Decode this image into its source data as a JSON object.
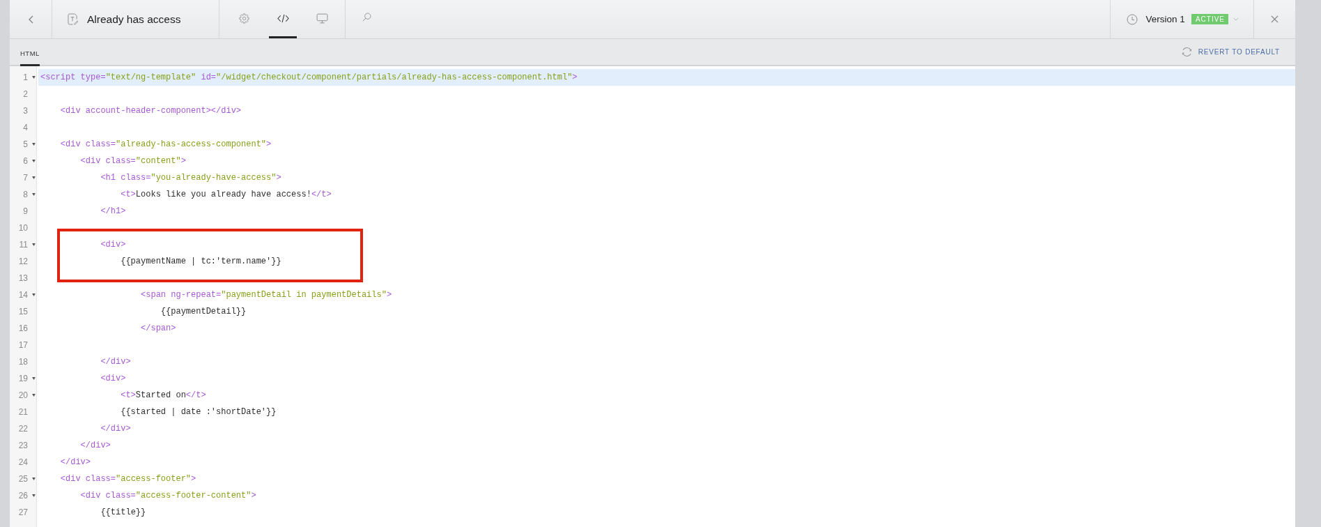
{
  "toolbar": {
    "title": "Already has access",
    "tabs": [
      {
        "kind": "settings",
        "selected": false
      },
      {
        "kind": "code",
        "selected": true
      },
      {
        "kind": "preview",
        "selected": false
      }
    ],
    "version": {
      "label": "Version 1",
      "status": "ACTIVE"
    }
  },
  "subtabs": [
    {
      "label": "HTML",
      "selected": true
    }
  ],
  "revert_button": "REVERT TO DEFAULT",
  "code": {
    "lines": [
      {
        "number": "1",
        "fold": true,
        "active": true,
        "boxed": false,
        "tokens": [
          {
            "kind": "tag",
            "text": "<script type="
          },
          {
            "kind": "string",
            "text": "\"text/ng-template\""
          },
          {
            "kind": "tag",
            "text": " id="
          },
          {
            "kind": "string",
            "text": "\"/widget/checkout/component/partials/already-has-access-component.html\""
          },
          {
            "kind": "tag",
            "text": ">"
          }
        ]
      },
      {
        "number": "2",
        "fold": false,
        "active": false,
        "boxed": false
      },
      {
        "number": "3",
        "fold": false,
        "active": false,
        "boxed": false,
        "tokens": [
          {
            "kind": "tag",
            "text": "    <div account-header-component></div>"
          }
        ]
      },
      {
        "number": "4",
        "fold": false,
        "active": false,
        "boxed": false
      },
      {
        "number": "5",
        "fold": true,
        "active": false,
        "boxed": false,
        "tokens": [
          {
            "kind": "tag",
            "text": "    <div class="
          },
          {
            "kind": "string",
            "text": "\"already-has-access-component\""
          },
          {
            "kind": "tag",
            "text": ">"
          }
        ]
      },
      {
        "number": "6",
        "fold": true,
        "active": false,
        "boxed": false,
        "tokens": [
          {
            "kind": "tag",
            "text": "        <div class="
          },
          {
            "kind": "string",
            "text": "\"content\""
          },
          {
            "kind": "tag",
            "text": ">"
          }
        ]
      },
      {
        "number": "7",
        "fold": true,
        "active": false,
        "boxed": false,
        "tokens": [
          {
            "kind": "tag",
            "text": "            <h1 class="
          },
          {
            "kind": "string",
            "text": "\"you-already-have-access\""
          },
          {
            "kind": "tag",
            "text": ">"
          }
        ]
      },
      {
        "number": "8",
        "fold": true,
        "active": false,
        "boxed": false,
        "tokens": [
          {
            "kind": "tag",
            "text": "                <t>"
          },
          {
            "kind": "text",
            "text": "Looks like you already have access!"
          },
          {
            "kind": "tag",
            "text": "</t>"
          }
        ]
      },
      {
        "number": "9",
        "fold": false,
        "active": false,
        "boxed": false,
        "tokens": [
          {
            "kind": "tag",
            "text": "            </h1>"
          }
        ]
      },
      {
        "number": "10",
        "fold": false,
        "active": false,
        "boxed": false
      },
      {
        "number": "11",
        "fold": true,
        "active": false,
        "boxed": true,
        "tokens": [
          {
            "kind": "tag",
            "text": "            <div>"
          }
        ]
      },
      {
        "number": "12",
        "fold": false,
        "active": false,
        "boxed": true,
        "tokens": [
          {
            "kind": "text",
            "text": "                {{paymentName | tc:'term.name'}}"
          }
        ]
      },
      {
        "number": "13",
        "fold": false,
        "active": false,
        "boxed": true
      },
      {
        "number": "14",
        "fold": true,
        "active": false,
        "boxed": false,
        "tokens": [
          {
            "kind": "tag",
            "text": "                    <span ng-repeat="
          },
          {
            "kind": "string",
            "text": "\"paymentDetail in paymentDetails\""
          },
          {
            "kind": "tag",
            "text": ">"
          }
        ]
      },
      {
        "number": "15",
        "fold": false,
        "active": false,
        "boxed": false,
        "tokens": [
          {
            "kind": "text",
            "text": "                        {{paymentDetail}}"
          }
        ]
      },
      {
        "number": "16",
        "fold": false,
        "active": false,
        "boxed": false,
        "tokens": [
          {
            "kind": "tag",
            "text": "                    </span>"
          }
        ]
      },
      {
        "number": "17",
        "fold": false,
        "active": false,
        "boxed": false
      },
      {
        "number": "18",
        "fold": false,
        "active": false,
        "boxed": false,
        "tokens": [
          {
            "kind": "tag",
            "text": "            </div>"
          }
        ]
      },
      {
        "number": "19",
        "fold": true,
        "active": false,
        "boxed": false,
        "tokens": [
          {
            "kind": "tag",
            "text": "            <div>"
          }
        ]
      },
      {
        "number": "20",
        "fold": true,
        "active": false,
        "boxed": false,
        "tokens": [
          {
            "kind": "tag",
            "text": "                <t>"
          },
          {
            "kind": "text",
            "text": "Started on"
          },
          {
            "kind": "tag",
            "text": "</t>"
          }
        ]
      },
      {
        "number": "21",
        "fold": false,
        "active": false,
        "boxed": false,
        "tokens": [
          {
            "kind": "text",
            "text": "                {{started | date :'shortDate'}}"
          }
        ]
      },
      {
        "number": "22",
        "fold": false,
        "active": false,
        "boxed": false,
        "tokens": [
          {
            "kind": "tag",
            "text": "            </div>"
          }
        ]
      },
      {
        "number": "23",
        "fold": false,
        "active": false,
        "boxed": false,
        "tokens": [
          {
            "kind": "tag",
            "text": "        </div>"
          }
        ]
      },
      {
        "number": "24",
        "fold": false,
        "active": false,
        "boxed": false,
        "tokens": [
          {
            "kind": "tag",
            "text": "    </div>"
          }
        ]
      },
      {
        "number": "25",
        "fold": true,
        "active": false,
        "boxed": false,
        "tokens": [
          {
            "kind": "tag",
            "text": "    <div class="
          },
          {
            "kind": "string",
            "text": "\"access-footer\""
          },
          {
            "kind": "tag",
            "text": ">"
          }
        ]
      },
      {
        "number": "26",
        "fold": true,
        "active": false,
        "boxed": false,
        "tokens": [
          {
            "kind": "tag",
            "text": "        <div class="
          },
          {
            "kind": "string",
            "text": "\"access-footer-content\""
          },
          {
            "kind": "tag",
            "text": ">"
          }
        ]
      },
      {
        "number": "27",
        "fold": false,
        "active": false,
        "boxed": false,
        "tokens": [
          {
            "kind": "text",
            "text": "            {{title}}"
          }
        ]
      }
    ]
  }
}
